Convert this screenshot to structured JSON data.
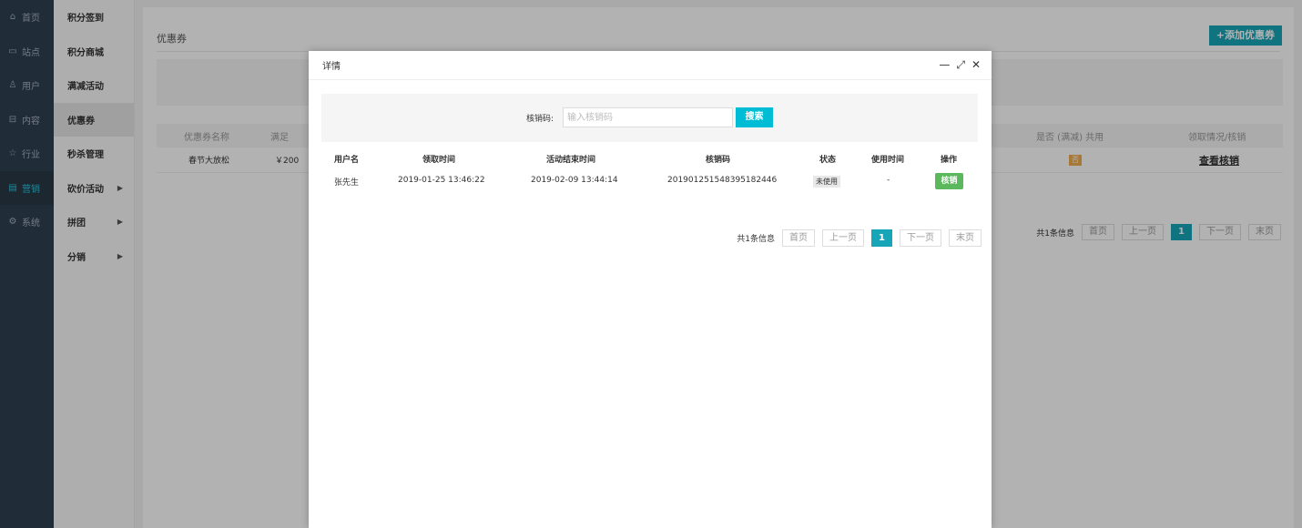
{
  "nav_main": [
    {
      "icon": "home-icon",
      "glyph": "⌂",
      "label": "首页"
    },
    {
      "icon": "monitor-icon",
      "glyph": "▭",
      "label": "站点"
    },
    {
      "icon": "user-icon",
      "glyph": "♙",
      "label": "用户"
    },
    {
      "icon": "inbox-icon",
      "glyph": "⊟",
      "label": "内容"
    },
    {
      "icon": "star-icon",
      "glyph": "☆",
      "label": "行业"
    },
    {
      "icon": "calendar-icon",
      "glyph": "▤",
      "label": "营销"
    },
    {
      "icon": "gear-icon",
      "glyph": "⚙",
      "label": "系统"
    }
  ],
  "nav_sub": [
    {
      "label": "积分签到"
    },
    {
      "label": "积分商城"
    },
    {
      "label": "满减活动"
    },
    {
      "label": "优惠券"
    },
    {
      "label": "秒杀管理"
    },
    {
      "label": "砍价活动"
    },
    {
      "label": "拼团"
    },
    {
      "label": "分销"
    }
  ],
  "page": {
    "title": "优惠券",
    "add_button": "+添加优惠券",
    "table_headers": {
      "name": "优惠券名称",
      "threshold": "满足",
      "shared": "是否 (满减) 共用",
      "ops": "领取情况/核销"
    },
    "row": {
      "name": "春节大放松",
      "threshold": "￥200",
      "shared_badge": "否",
      "ops_link": "查看核销"
    },
    "pager": {
      "info": "共1条信息",
      "first": "首页",
      "prev": "上一页",
      "current": "1",
      "next": "下一页",
      "last": "末页"
    }
  },
  "modal": {
    "title": "详情",
    "controls": {
      "minimize": "—",
      "maximize": "⤢",
      "close": "✕"
    },
    "search_label": "核销码:",
    "search_placeholder": "输入核销码",
    "search_button": "搜索",
    "headers": {
      "username": "用户名",
      "receive_time": "领取时间",
      "end_time": "活动结束时间",
      "code": "核销码",
      "status": "状态",
      "use_time": "使用时间",
      "action": "操作"
    },
    "row": {
      "username": "张先生",
      "receive_time": "2019-01-25 13:46:22",
      "end_time": "2019-02-09 13:44:14",
      "code": "20190125154839518244​6",
      "status": "未使用",
      "use_time": "-",
      "action": "核销"
    },
    "pager": {
      "info": "共1条信息",
      "first": "首页",
      "prev": "上一页",
      "current": "1",
      "next": "下一页",
      "last": "末页"
    }
  }
}
